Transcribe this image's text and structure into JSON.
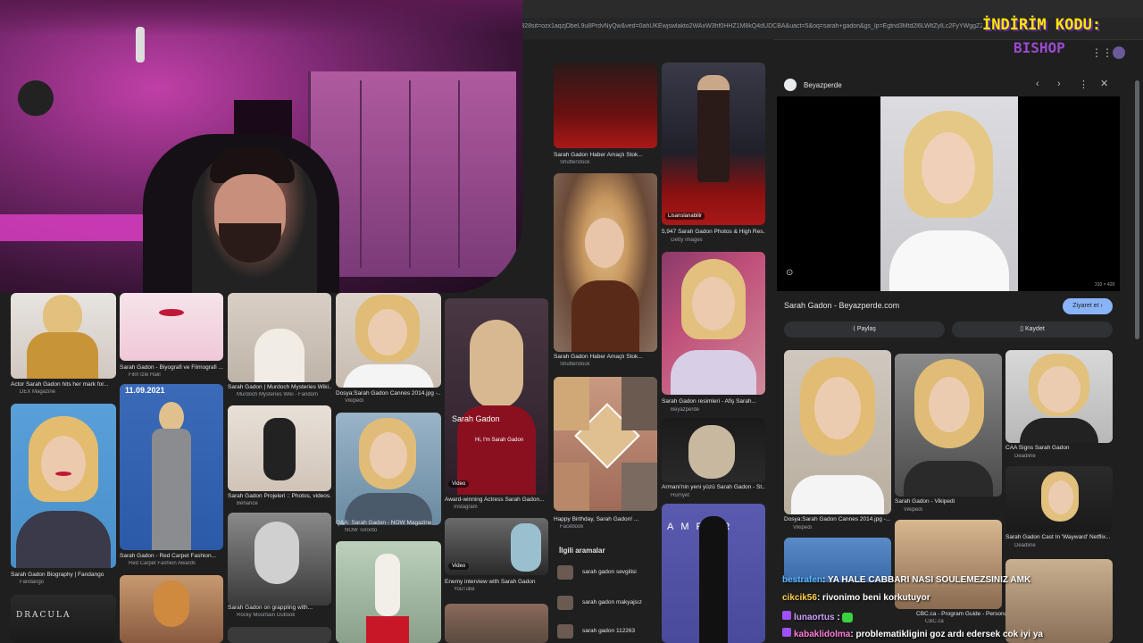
{
  "browser": {
    "url": "681312328sit=ozx1aqzjDbeL9u8PrdvNyQw&ved=0ahUKEwjswlakto2WAxW3hf0HHZ1M8kQ4dUDCBA&uact=5&oq=sarah+gadon&gs_lp=Egtnd3Mtd2l6LWltZyILc2FyYWggZ2Fk"
  },
  "promo": {
    "line1": "İNDİRİM KODU:",
    "line2": "BISHOP"
  },
  "results": [
    {
      "caption": "Sarah Gadon Haber Amaçlı Stok...",
      "source": "Shutterstock"
    },
    {
      "caption": "5,947 Sarah Gadon Photos & High Res...",
      "source": "Getty Images"
    },
    {
      "caption": "Sarah Gadon Haber Amaçlı Stok...",
      "source": "Shutterstock"
    },
    {
      "caption": "Sarah Gadon resimleri - Afiş Sarah...",
      "source": "Beyazperde"
    },
    {
      "caption": "Actor Sarah Gadon hits her mark for...",
      "source": "DEX Magazine"
    },
    {
      "caption": "Sarah Gadon - Biyografi ve Filmografi ...",
      "source": "Film Izle Halil"
    },
    {
      "caption": "Sarah Gadon | Murdoch Mysteries Wiki...",
      "source": "Murdoch Mysteries Wiki - Fandom"
    },
    {
      "caption": "Dosya:Sarah Gadon Cannes 2014.jpg -...",
      "source": "Vikipedi"
    },
    {
      "caption": "Sarah Gadon Biography | Fandango",
      "source": "Fandango"
    },
    {
      "caption": "Sarah Gadon - Red Carpet Fashion...",
      "source": "Red Carpet Fashion Awards"
    },
    {
      "caption": "Sarah Gadon Projeleri :: Photos, videos...",
      "source": "Behance"
    },
    {
      "caption": "Q&A: Sarah Gadon - NOW Magazine",
      "source": "NOW Toronto"
    },
    {
      "caption": "Award-winning Actress Sarah Gadon...",
      "source": "Instagram"
    },
    {
      "caption": "Happy Birthday, Sarah Gadon! ...",
      "source": "Facebook"
    },
    {
      "caption": "Armani'nin yeni yüzü Sarah Gadon - St...",
      "source": "Hürriyet"
    },
    {
      "caption": "Sarah Gadon on grappling with...",
      "source": "Rocky Mountain Outlook"
    },
    {
      "caption": "Enemy interview with Sarah Gadon",
      "source": "YouTube"
    },
    {
      "caption": "Interview: Sarah Gadon on the...",
      "source": ""
    }
  ],
  "badges": {
    "date": "11.09.2021",
    "video": "Video",
    "licensable": "Lisanslanabilir",
    "sarah_overlay": "Sarah Gadon",
    "hi_text": "Hi, I'm Sarah Gadon",
    "dracula": "DRACULA"
  },
  "related": {
    "title": "İlgili aramalar",
    "items": [
      "sarah gadon sevgilisi",
      "sarah gadon makyajsız",
      "sarah gadon 112263"
    ]
  },
  "panel": {
    "source_name": "Beyazperde",
    "size": "310 × 420",
    "title": "Sarah Gadon - Beyazperde.com",
    "visit": "Ziyaret et",
    "share": "Paylaş",
    "save": "Kaydet",
    "related": [
      {
        "caption": "Dosya:Sarah Gadon Cannes 2014.jpg -...",
        "source": "Vikipedi"
      },
      {
        "caption": "Sarah Gadon - Vikipedi",
        "source": "Vikipedi"
      },
      {
        "caption": "CAA Signs Sarah Gadon",
        "source": "Deadline"
      },
      {
        "caption": "Sarah Gadon Cast In 'Wayward' Netflix...",
        "source": "Deadline"
      },
      {
        "caption": "CBC.ca - Program Guide - Personalities",
        "source": "CBC.ca"
      }
    ]
  },
  "chat": [
    {
      "user": "bestrafen",
      "msg": ": YA HALE CABBARI NASI SOULEMEZSINIZ AMK",
      "color": "#5ab4ff"
    },
    {
      "user": "cikcik56",
      "msg": ": rivonimo beni korkutuyor",
      "color": "#ffd24a"
    },
    {
      "user": "lunaortus",
      "msg": ":",
      "color": "#d0a0ff"
    },
    {
      "user": "kabaklidolma",
      "msg": ": problematikligini goz ardı edersek cok iyi ya",
      "color": "#ff7ad9"
    }
  ]
}
